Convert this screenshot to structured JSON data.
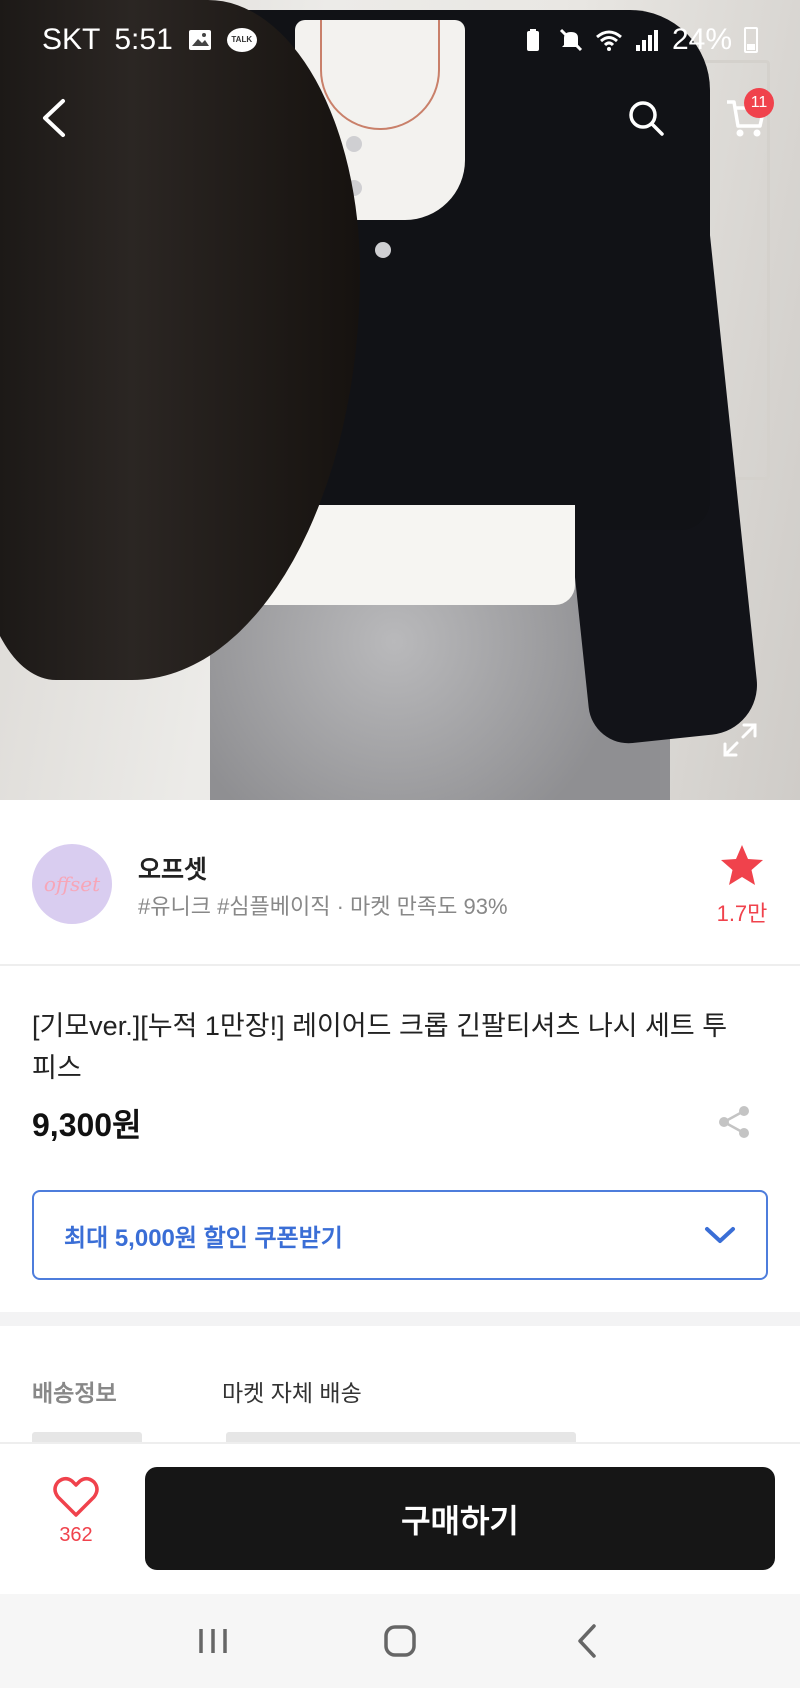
{
  "status_bar": {
    "carrier": "SKT",
    "time": "5:51",
    "kakao_talk_label": "TALK",
    "battery": "24%"
  },
  "header": {
    "cart_badge": "11"
  },
  "store": {
    "logo_text": "offset",
    "name": "오프셋",
    "tags": "#유니크 #심플베이직 · 마켓 만족도 93%",
    "favorite_count": "1.7만"
  },
  "product": {
    "title": "[기모ver.][누적 1만장!] 레이어드 크롭 긴팔티셔츠 나시 세트 투피스",
    "price": "9,300원"
  },
  "coupon": {
    "label": "최대 5,000원 할인 쿠폰받기"
  },
  "shipping": {
    "label": "배송정보",
    "value": "마켓 자체 배송"
  },
  "bottom_bar": {
    "like_count": "362",
    "buy_label": "구매하기"
  },
  "colors": {
    "accent_red": "#f0424c",
    "coupon_blue": "#3a6ed6",
    "buy_button": "#161616"
  }
}
